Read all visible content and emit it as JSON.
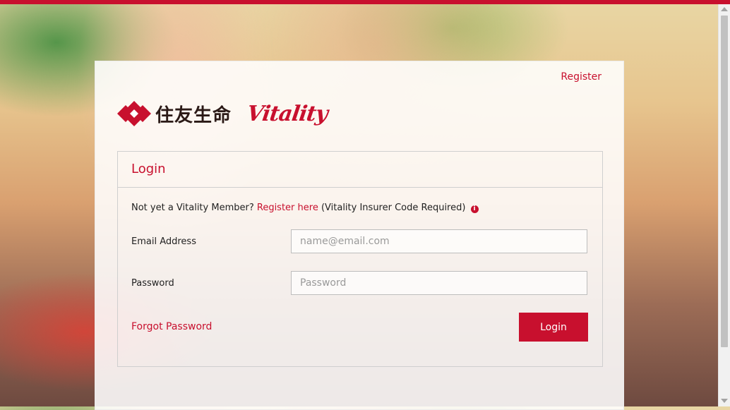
{
  "header": {
    "register_label": "Register"
  },
  "brand": {
    "kanji": "住友生命",
    "vitality": "Vitality",
    "color": "#c8102e"
  },
  "login": {
    "title": "Login",
    "prompt_prefix": "Not yet a Vitality Member?",
    "register_here": "Register here",
    "prompt_suffix": "(Vitality Insurer Code Required)",
    "info_icon": "info-circle-icon",
    "email_label": "Email Address",
    "email_placeholder": "name@email.com",
    "password_label": "Password",
    "password_placeholder": "Password",
    "forgot_password": "Forgot Password",
    "submit_label": "Login"
  }
}
